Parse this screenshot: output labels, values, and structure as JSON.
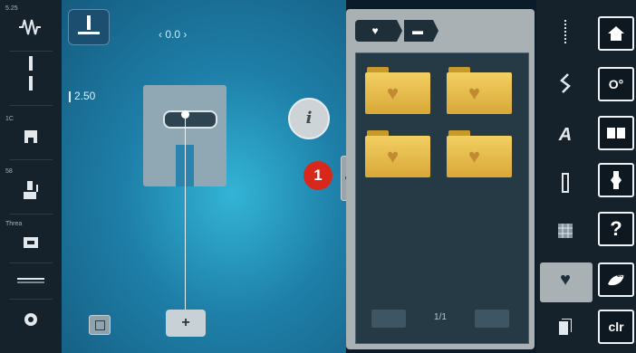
{
  "app": {
    "accent": "#d8281c",
    "panel_color": "#a9b1b5",
    "folder_color": "#e9bd4c"
  },
  "left_sidebar": {
    "items": [
      {
        "label": "5.25",
        "icon": "stitch-width-icon"
      },
      {
        "label": "",
        "icon": "stitch-length-icon"
      },
      {
        "label": "1C",
        "icon": "presser-foot-icon"
      },
      {
        "label": "58",
        "icon": "presser-foot-pressure-icon"
      },
      {
        "label": "",
        "icon": "feed-dog-icon"
      },
      {
        "label": "",
        "icon": "stitch-plate-icon"
      },
      {
        "label": "",
        "icon": "thread-tension-icon"
      }
    ]
  },
  "main": {
    "needle_position_value": "‹ 0.0 ›",
    "stitch_length_value": "2.50",
    "info_button_label": "i",
    "callout_number": "1",
    "move_button_label": "+"
  },
  "panel": {
    "breadcrumb": [
      {
        "icon": "heart-icon"
      },
      {
        "icon": "folder-icon"
      }
    ],
    "folders": [
      {
        "icon": "heart-icon"
      },
      {
        "icon": "heart-icon"
      },
      {
        "icon": "heart-icon"
      },
      {
        "icon": "heart-icon"
      }
    ],
    "page_indicator": "1/1"
  },
  "category_strip": {
    "items": [
      {
        "icon": "practical-stitches-icon"
      },
      {
        "icon": "decorative-stitches-icon"
      },
      {
        "icon": "alphabets-icon"
      },
      {
        "icon": "buttonholes-icon"
      },
      {
        "icon": "quilt-stitches-icon"
      },
      {
        "icon": "personal-program-heart-icon",
        "selected": true
      },
      {
        "icon": "memory-icon"
      }
    ]
  },
  "right_sidebar": {
    "buttons": [
      {
        "icon": "home-icon"
      },
      {
        "icon": "setup-icon"
      },
      {
        "icon": "tutorial-icon"
      },
      {
        "icon": "sewing-consultant-icon"
      },
      {
        "icon": "help-icon",
        "label": "?"
      },
      {
        "icon": "eco-mode-icon"
      },
      {
        "label": "clr"
      }
    ]
  }
}
